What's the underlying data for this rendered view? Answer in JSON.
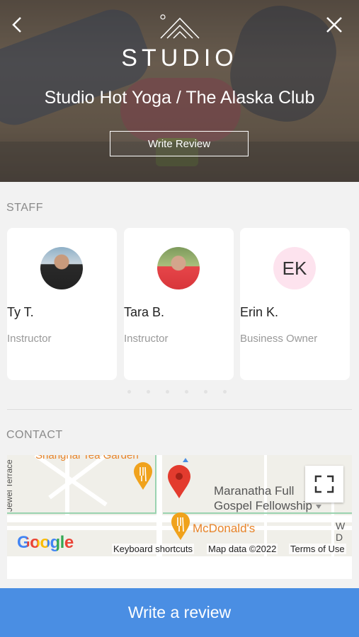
{
  "header": {
    "logo_text": "STUDIO",
    "studio_name": "Studio Hot Yoga / The Alaska Club",
    "write_review_label": "Write Review"
  },
  "staff": {
    "section_label": "STAFF",
    "members": [
      {
        "name": "Ty T.",
        "role": "Instructor",
        "avatar": "photo"
      },
      {
        "name": "Tara B.",
        "role": "Instructor",
        "avatar": "photo"
      },
      {
        "name": "Erin K.",
        "role": "Business Owner",
        "avatar": "initials",
        "initials": "EK"
      }
    ]
  },
  "contact": {
    "section_label": "CONTACT",
    "map": {
      "labels": {
        "restaurant_top": "Shanghai Tea Garden",
        "street_left": "Jewel Terrace",
        "church": "Maranatha Full\nGospel Fellowship",
        "mcdonalds": "McDonald's",
        "street_right": "W D"
      },
      "attribution": {
        "google": "Google",
        "keyboard": "Keyboard shortcuts",
        "map_data": "Map data ©2022",
        "terms": "Terms of Use"
      }
    }
  },
  "footer": {
    "write_review_label": "Write a review"
  },
  "colors": {
    "accent": "#4a8ee3",
    "avatar_initials_bg": "#fde3ee",
    "map_pin": "#e33b2e",
    "food_pin": "#f0a21c"
  }
}
